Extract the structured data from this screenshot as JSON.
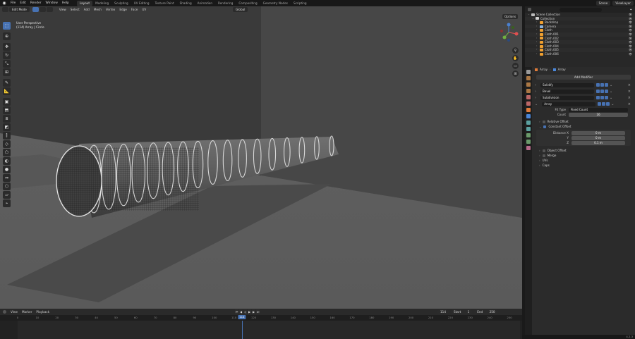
{
  "topbar": {
    "menus": [
      "File",
      "Edit",
      "Render",
      "Window",
      "Help"
    ],
    "workspaces": [
      "Layout",
      "Modeling",
      "Sculpting",
      "UV Editing",
      "Texture Paint",
      "Shading",
      "Animation",
      "Rendering",
      "Compositing",
      "Geometry Nodes",
      "Scripting"
    ],
    "active_workspace": "Layout",
    "scene": "Scene",
    "view_layer": "ViewLayer"
  },
  "viewport": {
    "mode": "Edit Mode",
    "menus": [
      "View",
      "Select",
      "Add",
      "Mesh",
      "Vertex",
      "Edge",
      "Face",
      "UV"
    ],
    "transform_orientation": "Global",
    "options_label": "Options",
    "info_line1": "User Perspective",
    "info_line2": "(114) Array | Circle"
  },
  "outliner": {
    "search_placeholder": "",
    "items": [
      {
        "label": "Scene Collection",
        "indent": 0,
        "color": "#bbbbbb"
      },
      {
        "label": "Collection",
        "indent": 1,
        "color": "#d0d0d0"
      },
      {
        "label": "Backdrop",
        "indent": 2,
        "color": "#f0a030"
      },
      {
        "label": "Camera",
        "indent": 2,
        "color": "#8fb3d9"
      },
      {
        "label": "Cloth",
        "indent": 2,
        "color": "#f0a030"
      },
      {
        "label": "Cloth.001",
        "indent": 2,
        "color": "#f0a030"
      },
      {
        "label": "Cloth.002",
        "indent": 2,
        "color": "#f0a030"
      },
      {
        "label": "Cloth.003",
        "indent": 2,
        "color": "#f0a030"
      },
      {
        "label": "Cloth.004",
        "indent": 2,
        "color": "#f0a030"
      },
      {
        "label": "Cloth.005",
        "indent": 2,
        "color": "#f0a030"
      },
      {
        "label": "Cloth.006",
        "indent": 2,
        "color": "#f0a030"
      }
    ]
  },
  "properties": {
    "breadcrumb_object": "Array",
    "breadcrumb_modifier": "Array",
    "add_modifier": "Add Modifier",
    "modifiers": [
      {
        "name": "Solidify"
      },
      {
        "name": "Bevel"
      },
      {
        "name": "Subdivision"
      },
      {
        "name": "Array"
      }
    ],
    "array": {
      "fit_type_label": "Fit Type",
      "fit_type_value": "Fixed Count",
      "count_label": "Count",
      "count_value": "16",
      "relative_offset": "Relative Offset",
      "constant_offset": "Constant Offset",
      "distance_x_label": "Distance X",
      "distance_x": "0 m",
      "y_label": "Y",
      "y_value": "0 m",
      "z_label": "Z",
      "z_value": "0.1 m",
      "object_offset": "Object Offset",
      "merge": "Merge",
      "uvs": "UVs",
      "caps": "Caps"
    }
  },
  "timeline": {
    "menus": [
      "View",
      "Marker",
      "Playback"
    ],
    "current_frame": "114",
    "start_label": "Start",
    "start_value": "1",
    "end_label": "End",
    "end_value": "250",
    "ticks": [
      "0",
      "10",
      "20",
      "30",
      "40",
      "50",
      "60",
      "70",
      "80",
      "90",
      "100",
      "110",
      "120",
      "130",
      "140",
      "150",
      "160",
      "170",
      "180",
      "190",
      "200",
      "210",
      "220",
      "230",
      "240",
      "250"
    ],
    "playhead": "114"
  },
  "statusbar": {
    "version": "4.2.3"
  },
  "colors": {
    "accent": "#4772b3",
    "viewport_bg": "#3d3d3d",
    "floor": "#595959"
  }
}
